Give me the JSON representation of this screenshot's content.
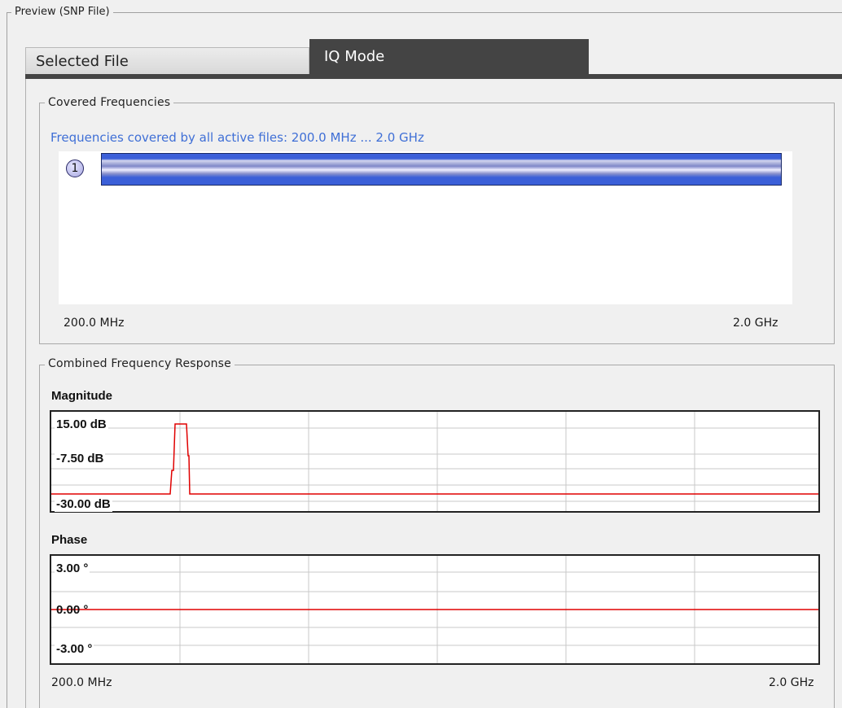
{
  "preview": {
    "title": "Preview (SNP File)"
  },
  "tabs": [
    {
      "label": "Selected File",
      "active": false
    },
    {
      "label": "IQ Mode",
      "active": true
    }
  ],
  "covered_frequencies": {
    "title": "Covered Frequencies",
    "info": "Frequencies covered by all active files: 200.0 MHz ... 2.0 GHz",
    "files": [
      {
        "badge": "1",
        "start": "200.0 MHz",
        "stop": "2.0 GHz"
      }
    ],
    "axis_start": "200.0 MHz",
    "axis_end": "2.0 GHz"
  },
  "combined_response": {
    "title": "Combined Frequency Response",
    "magnitude": {
      "label": "Magnitude",
      "ticks": [
        "15.00 dB",
        "-7.50 dB",
        "-30.00 dB"
      ],
      "trace_color": "#e00000"
    },
    "phase": {
      "label": "Phase",
      "ticks": [
        "3.00 °",
        "0.00 °",
        "-3.00 °"
      ],
      "trace_color": "#e00000"
    },
    "axis_start": "200.0 MHz",
    "axis_end": "2.0 GHz"
  },
  "colors": {
    "active_tab": "#444444",
    "info_text": "#3f6fd6",
    "coverage_bar": "#3b5fd8",
    "trace": "#e00000"
  }
}
